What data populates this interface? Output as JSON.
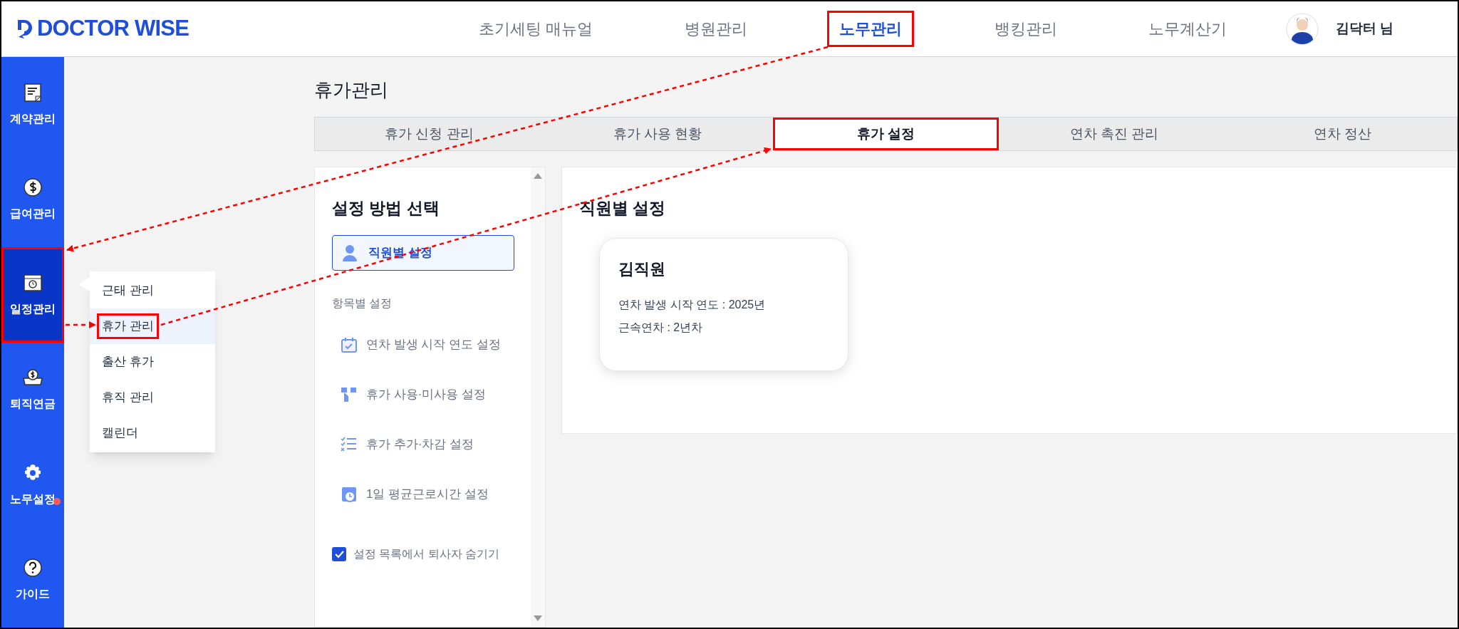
{
  "header": {
    "logo": "DOCTOR WISE",
    "nav": [
      {
        "label": "초기세팅 매뉴얼",
        "selected": false,
        "highlighted": false
      },
      {
        "label": "병원관리",
        "selected": false,
        "highlighted": false
      },
      {
        "label": "노무관리",
        "selected": true,
        "highlighted": true
      },
      {
        "label": "뱅킹관리",
        "selected": false,
        "highlighted": false
      },
      {
        "label": "노무계산기",
        "selected": false,
        "highlighted": false
      }
    ],
    "user": "김닥터 님"
  },
  "sidebar": {
    "items": [
      {
        "label": "계약관리",
        "kind": "document",
        "selected": false,
        "highlighted": false,
        "badge": false
      },
      {
        "label": "급여관리",
        "kind": "coin",
        "selected": false,
        "highlighted": false,
        "badge": false
      },
      {
        "label": "일정관리",
        "kind": "schedule",
        "selected": true,
        "highlighted": true,
        "badge": false
      },
      {
        "label": "퇴직연금",
        "kind": "money",
        "selected": false,
        "highlighted": false,
        "badge": false
      },
      {
        "label": "노무설정",
        "kind": "gear",
        "selected": false,
        "highlighted": false,
        "badge": true
      },
      {
        "label": "가이드",
        "kind": "help",
        "selected": false,
        "highlighted": false,
        "badge": false
      }
    ]
  },
  "submenu": {
    "items": [
      {
        "label": "근태 관리",
        "selected": false,
        "highlighted": false
      },
      {
        "label": "휴가 관리",
        "selected": true,
        "highlighted": true
      },
      {
        "label": "출산 휴가",
        "selected": false,
        "highlighted": false
      },
      {
        "label": "휴직 관리",
        "selected": false,
        "highlighted": false
      },
      {
        "label": "캘린더",
        "selected": false,
        "highlighted": false
      }
    ]
  },
  "page_title": "휴가관리",
  "tabs": [
    {
      "label": "휴가 신청 관리",
      "selected": false,
      "highlighted": false
    },
    {
      "label": "휴가 사용 현황",
      "selected": false,
      "highlighted": false
    },
    {
      "label": "휴가 설정",
      "selected": true,
      "highlighted": true
    },
    {
      "label": "연차 촉진 관리",
      "selected": false,
      "highlighted": false
    },
    {
      "label": "연차 정산",
      "selected": false,
      "highlighted": false
    }
  ],
  "settings_panel": {
    "title": "설정 방법 선택",
    "method": {
      "label": "직원별 설정",
      "selected": true
    },
    "section_label": "항목별 설정",
    "items": [
      {
        "label": "연차 발생 시작 연도 설정",
        "kind": "calendar"
      },
      {
        "label": "휴가 사용·미사용 설정",
        "kind": "toggle"
      },
      {
        "label": "휴가 추가·차감 설정",
        "kind": "checklist"
      },
      {
        "label": "1일 평균근로시간 설정",
        "kind": "clock"
      }
    ],
    "hide_resigned": {
      "label": "설정 목록에서 퇴사자 숨기기",
      "checked": true
    }
  },
  "detail": {
    "title": "직원별 설정",
    "employees": [
      {
        "name": "김직원",
        "lines": [
          "연차 발생 시작 연도 : 2025년",
          "근속연차 : 2년차"
        ]
      }
    ]
  }
}
